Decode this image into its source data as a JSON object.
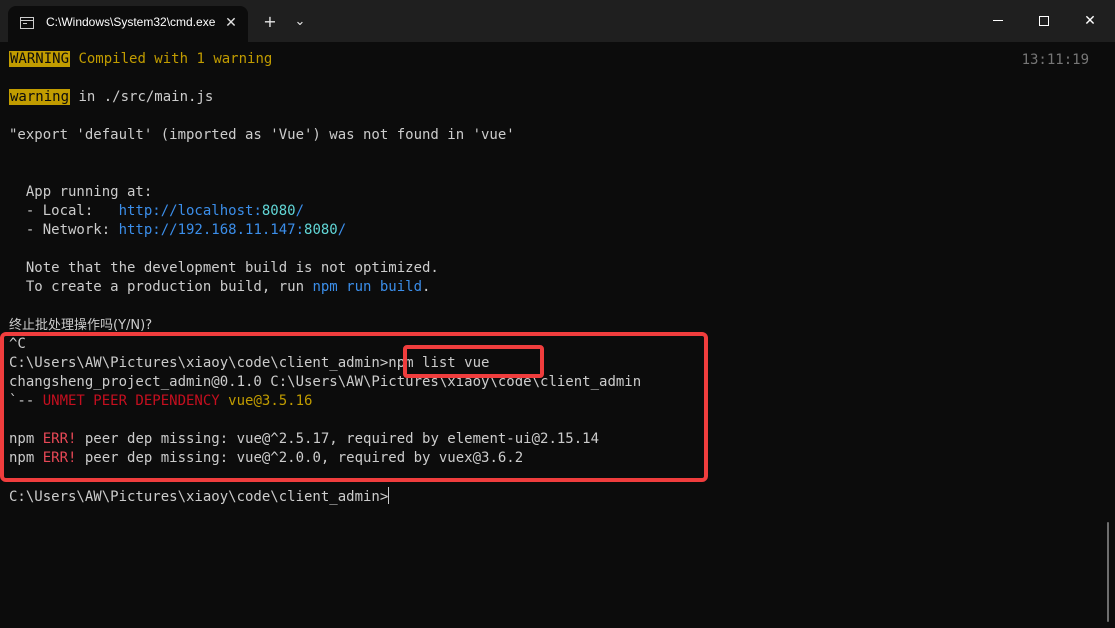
{
  "window": {
    "tab_title": "C:\\Windows\\System32\\cmd.exe",
    "tab_icon": "terminal-icon",
    "new_tab_symbol": "+",
    "dropdown_symbol": "⌄",
    "close_tab_symbol": "✕",
    "minimize_icon": "minimize-icon",
    "maximize_icon": "maximize-icon",
    "close_symbol": "✕"
  },
  "terminal": {
    "timestamp": "13:11:19",
    "warning_badge": "WARNING",
    "compiled_msg": "Compiled with 1 warning",
    "warning_badge2": "warning",
    "warning_location": "in ./src/main.js",
    "export_error": "\"export 'default' (imported as 'Vue') was not found in 'vue'",
    "app_running": "  App running at:",
    "local_label": "  - Local:   ",
    "local_url_prefix": "http://localhost:",
    "local_port": "8080",
    "local_url_suffix": "/",
    "network_label": "  - Network: ",
    "network_url_prefix": "http://192.168.11.147:",
    "network_port": "8080",
    "network_url_suffix": "/",
    "note_line1": "  Note that the development build is not optimized.",
    "note_line2_pre": "  To create a production build, run ",
    "npm_cmd": "npm run build",
    "note_line2_post": ".",
    "terminate_prompt": "终止批处理操作吗(Y/N)?",
    "ctrl_c": "^C",
    "prompt1": "C:\\Users\\AW\\Pictures\\xiaoy\\code\\client_admin>",
    "command1": "npm list vue",
    "package_line": "changsheng_project_admin@0.1.0 C:\\Users\\AW\\Pictures\\xiaoy\\code\\client_admin",
    "tree_prefix": "`-- ",
    "unmet": "UNMET PEER DEPENDENCY",
    "vue_version": "vue@3.5.16",
    "err1_pre": "npm ",
    "err1_tag": "ERR!",
    "err1_msg": " peer dep missing: vue@^2.5.17, required by element-ui@2.15.14",
    "err2_pre": "npm ",
    "err2_tag": "ERR!",
    "err2_msg": " peer dep missing: vue@^2.0.0, required by vuex@3.6.2",
    "prompt2": "C:\\Users\\AW\\Pictures\\xiaoy\\code\\client_admin>"
  },
  "colors": {
    "background": "#0c0c0c",
    "text": "#cccccc",
    "warning": "#c19c00",
    "link": "#3b8eea",
    "error": "#e74856",
    "highlight": "#f03d3d"
  }
}
